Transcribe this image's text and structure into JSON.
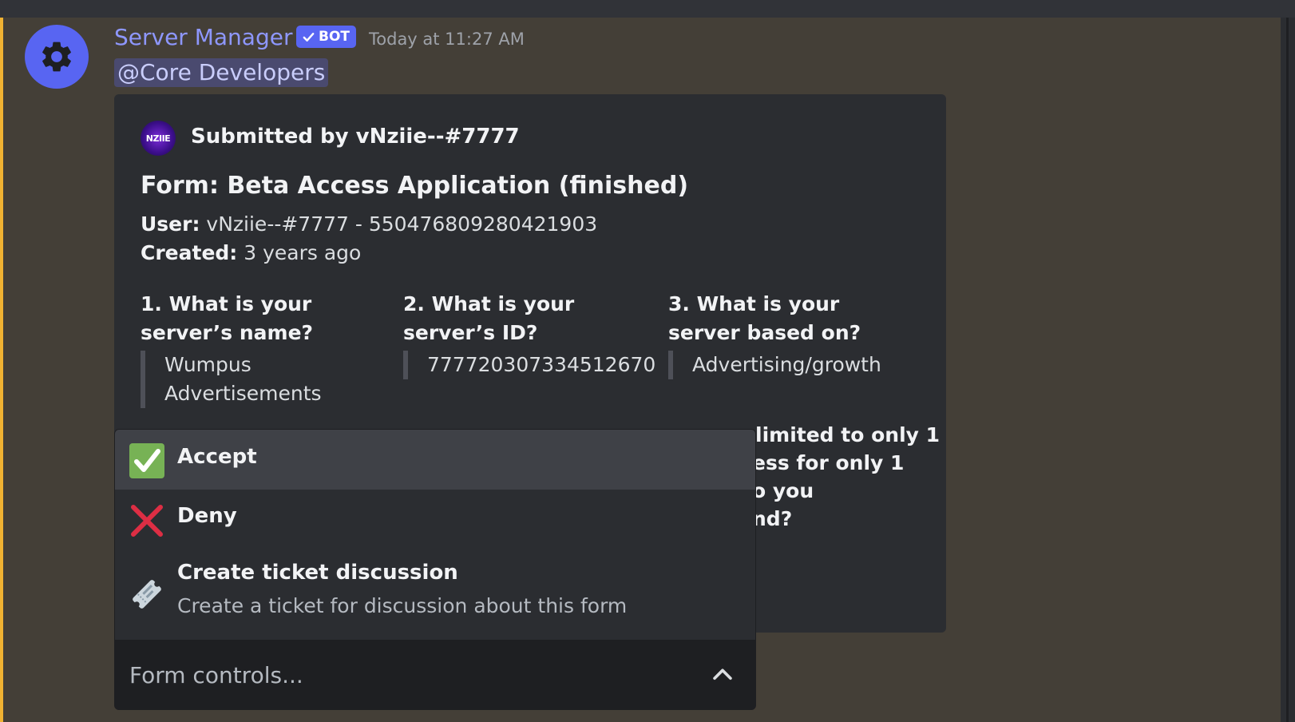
{
  "message": {
    "author": "Server Manager",
    "bot_badge": "BOT",
    "timestamp": "Today at 11:27 AM",
    "mention": "@Core Developers"
  },
  "embed": {
    "author": "Submitted by vNziie--#7777",
    "author_icon_text": "NZIIE",
    "title": "Form: Beta Access Application (finished)",
    "user_label": "User:",
    "user_value": "vNziie--#7777 - 550476809280421903",
    "created_label": "Created:",
    "created_value": "3 years ago",
    "fields": [
      {
        "name": "1. What is your server’s name?",
        "value": "Wumpus Advertisements"
      },
      {
        "name": "2. What is your server’s ID?",
        "value": "777720307334512670"
      },
      {
        "name": "3. What is your server based on?",
        "value": "Advertising/growth"
      }
    ],
    "partial_field_lines": [
      "limited to only 1",
      "ess for only 1",
      "o you",
      "nd?"
    ]
  },
  "menu": {
    "options": [
      {
        "label": "Accept",
        "icon": "check-mark-icon",
        "selected": true
      },
      {
        "label": "Deny",
        "icon": "cross-mark-icon"
      },
      {
        "label": "Create ticket discussion",
        "description": "Create a ticket for discussion about this form",
        "icon": "ticket-icon"
      }
    ],
    "placeholder": "Form controls..."
  },
  "colors": {
    "background": "#443f37",
    "accent_bar": "#f0b232",
    "author_name": "#8e97ff",
    "bot_badge": "#5865f2",
    "embed": "#2b2d31",
    "accept": "#77b255",
    "deny": "#dd2e44"
  }
}
